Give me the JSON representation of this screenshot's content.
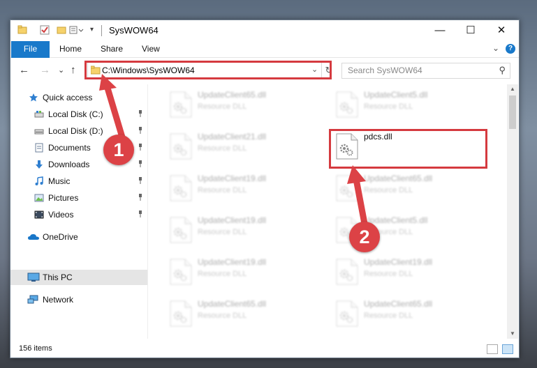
{
  "window": {
    "title": "SysWOW64",
    "minimize": "—",
    "maximize": "☐",
    "close": "✕"
  },
  "ribbon": {
    "tabs": [
      "File",
      "Home",
      "Share",
      "View"
    ],
    "expand": "⌄",
    "help": "?"
  },
  "nav": {
    "back": "←",
    "forward": "→",
    "recent": "⌄",
    "up": "↑",
    "address": "C:\\Windows\\SysWOW64",
    "address_drop": "⌄",
    "refresh": "↻",
    "search_placeholder": "Search SysWOW64",
    "search_icon": "⚲"
  },
  "sidebar": [
    {
      "label": "Quick access",
      "icon": "star-icon",
      "pinned": false
    },
    {
      "label": "Local Disk (C:)",
      "icon": "drive-icon",
      "pinned": true
    },
    {
      "label": "Local Disk (D:)",
      "icon": "drive-icon",
      "pinned": true
    },
    {
      "label": "Documents",
      "icon": "documents-icon",
      "pinned": true
    },
    {
      "label": "Downloads",
      "icon": "download-icon",
      "pinned": true
    },
    {
      "label": "Music",
      "icon": "music-icon",
      "pinned": true
    },
    {
      "label": "Pictures",
      "icon": "pictures-icon",
      "pinned": true
    },
    {
      "label": "Videos",
      "icon": "videos-icon",
      "pinned": true
    },
    {
      "label": "OneDrive",
      "icon": "cloud-icon",
      "pinned": false
    },
    {
      "label": "This PC",
      "icon": "computer-icon",
      "pinned": false,
      "selected": true
    },
    {
      "label": "Network",
      "icon": "network-icon",
      "pinned": false
    }
  ],
  "files": [
    {
      "name": "UpdateClient65.dll",
      "type": "Resource DLL",
      "blurred": true
    },
    {
      "name": "UpdateClient5.dll",
      "type": "Resource DLL",
      "blurred": true
    },
    {
      "name": "UpdateClient21.dll",
      "type": "Resource DLL",
      "blurred": true
    },
    {
      "name": "pdcs.dll",
      "type": "",
      "blurred": false
    },
    {
      "name": "UpdateClient19.dll",
      "type": "Resource DLL",
      "blurred": true
    },
    {
      "name": "UpdateClient65.dll",
      "type": "Resource DLL",
      "blurred": true
    },
    {
      "name": "UpdateClient19.dll",
      "type": "Resource DLL",
      "blurred": true
    },
    {
      "name": "UpdateClient5.dll",
      "type": "Resource DLL",
      "blurred": true
    },
    {
      "name": "UpdateClient19.dll",
      "type": "Resource DLL",
      "blurred": true
    },
    {
      "name": "UpdateClient19.dll",
      "type": "Resource DLL",
      "blurred": true
    },
    {
      "name": "UpdateClient65.dll",
      "type": "Resource DLL",
      "blurred": true
    },
    {
      "name": "UpdateClient65.dll",
      "type": "Resource DLL",
      "blurred": true
    }
  ],
  "status": {
    "items": "156 items"
  },
  "annotations": {
    "step1": "1",
    "step2": "2",
    "color": "#d53a3f"
  }
}
